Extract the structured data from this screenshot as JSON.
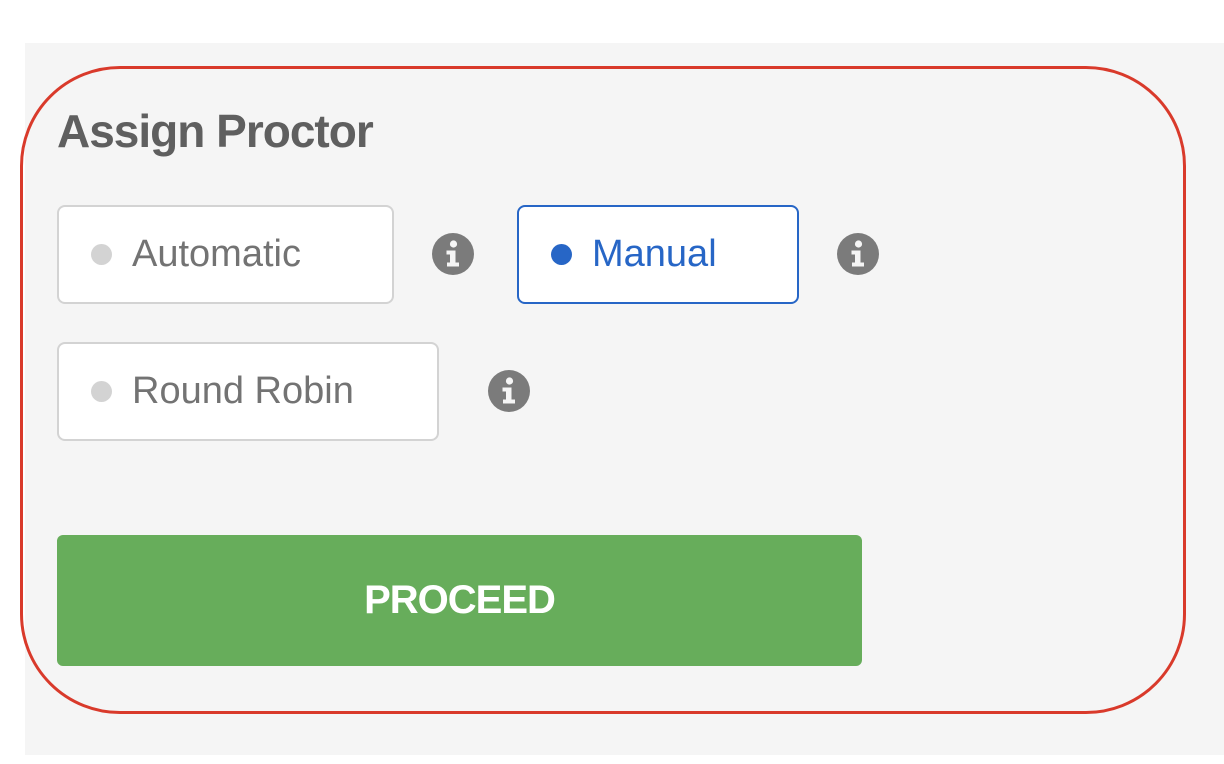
{
  "section": {
    "title": "Assign Proctor"
  },
  "options": [
    {
      "label": "Automatic",
      "selected": false
    },
    {
      "label": "Manual",
      "selected": true
    },
    {
      "label": "Round Robin",
      "selected": false
    }
  ],
  "icons": {
    "info": "info-icon",
    "radio": "radio-dot-icon"
  },
  "proceed_label": "PROCEED",
  "colors": {
    "accent": "#2766c6",
    "success": "#67ad5b",
    "annotation": "#d93a2b",
    "panel_bg": "#f5f5f5",
    "muted": "#d3d3d3",
    "text": "#5f5f5f",
    "icon": "#7b7b7b"
  }
}
